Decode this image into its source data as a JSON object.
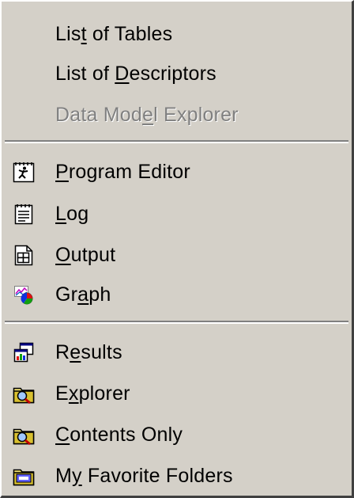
{
  "menu": {
    "items_top": [
      {
        "name": "menu-item-list-of-tables",
        "label_pre": "Lis",
        "label_key": "t",
        "label_post": " of Tables",
        "enabled": true
      },
      {
        "name": "menu-item-list-of-descriptors",
        "label_pre": "List of ",
        "label_key": "D",
        "label_post": "escriptors",
        "enabled": true
      },
      {
        "name": "menu-item-data-model-explorer",
        "label_pre": "Data Mod",
        "label_key": "e",
        "label_post": "l Explorer",
        "enabled": false
      }
    ],
    "items_middle": [
      {
        "name": "menu-item-program-editor",
        "icon": "program-editor-icon",
        "label_pre": "",
        "label_key": "P",
        "label_post": "rogram Editor",
        "enabled": true
      },
      {
        "name": "menu-item-log",
        "icon": "log-icon",
        "label_pre": "",
        "label_key": "L",
        "label_post": "og",
        "enabled": true
      },
      {
        "name": "menu-item-output",
        "icon": "output-icon",
        "label_pre": "",
        "label_key": "O",
        "label_post": "utput",
        "enabled": true
      },
      {
        "name": "menu-item-graph",
        "icon": "graph-icon",
        "label_pre": "Gr",
        "label_key": "a",
        "label_post": "ph",
        "enabled": true
      }
    ],
    "items_bottom": [
      {
        "name": "menu-item-results",
        "icon": "results-icon",
        "label_pre": "R",
        "label_key": "e",
        "label_post": "sults",
        "enabled": true
      },
      {
        "name": "menu-item-explorer",
        "icon": "explorer-icon",
        "label_pre": "E",
        "label_key": "x",
        "label_post": "plorer",
        "enabled": true
      },
      {
        "name": "menu-item-contents-only",
        "icon": "contents-only-icon",
        "label_pre": "",
        "label_key": "C",
        "label_post": "ontents Only",
        "enabled": true
      },
      {
        "name": "menu-item-my-favorite-folders",
        "icon": "favorite-folders-icon",
        "label_pre": "M",
        "label_key": "y",
        "label_post": " Favorite Folders",
        "enabled": true
      }
    ]
  },
  "colors": {
    "menu_bg": "#d4d0c8",
    "disabled_text": "#808080",
    "separator_dark": "#808080",
    "separator_light": "#ffffff"
  }
}
